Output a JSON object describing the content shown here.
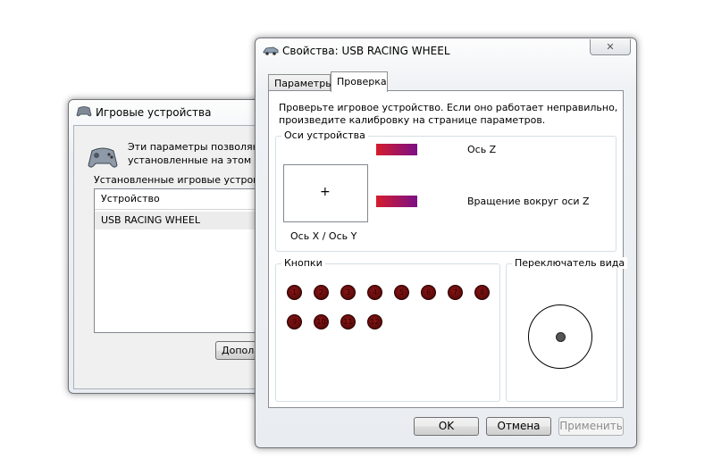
{
  "background_window": {
    "title": "Игровые устройства",
    "description_line1": "Эти параметры позволяют н",
    "description_line2": "установленные на этом ком",
    "installed_label": "Установленные игровые устройс",
    "list_header": "Устройство",
    "devices": [
      "USB RACING WHEEL"
    ],
    "advanced_button": "Дополн"
  },
  "dialog": {
    "title": "Свойства: USB RACING WHEEL",
    "close_icon": "close-x-icon",
    "tabs": [
      {
        "label": "Параметры",
        "active": false
      },
      {
        "label": "Проверка",
        "active": true
      }
    ],
    "instructions_line1": "Проверьте игровое устройство. Если оно работает неправильно,",
    "instructions_line2": "произведите калибровку на странице параметров.",
    "axes": {
      "group_title": "Оси устройства",
      "xy_label": "Ось X / Ось Y",
      "crosshair": "+",
      "z_label": "Ось Z",
      "rz_label": "Вращение вокруг оси Z",
      "bar_colors": [
        "#d41c2e",
        "#7a1085"
      ]
    },
    "buttons_group": {
      "title": "Кнопки",
      "buttons": [
        "1",
        "2",
        "3",
        "4",
        "5",
        "6",
        "7",
        "8",
        "9",
        "10",
        "11",
        "12"
      ],
      "led_color": "#6b0e0e"
    },
    "pov": {
      "title": "Переключатель вида"
    },
    "ok_label": "OK",
    "cancel_label": "Отмена",
    "apply_label": "Применить"
  }
}
